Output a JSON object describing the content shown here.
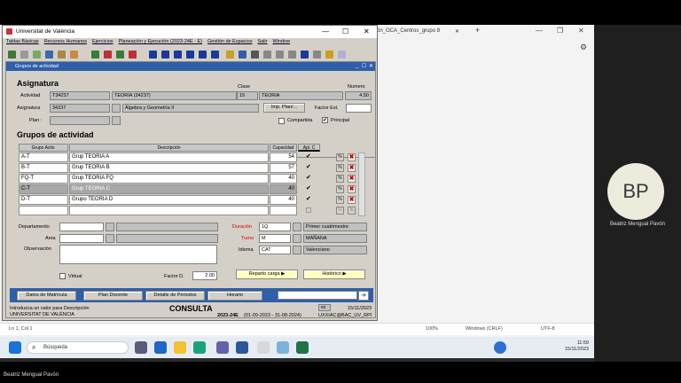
{
  "browser": {
    "tab_title": "ón_OCA_Centros_grupo 8",
    "new_tab": "+"
  },
  "app": {
    "title": "Universitat de València",
    "menu": [
      "Tablas Básicas",
      "Recursos Humanos",
      "Ejercicios",
      "Planeación y Ejecución (2023-24E - E)",
      "Gestión de Espacios",
      "Salir",
      "Window"
    ],
    "form_title": "Grupos de actividad",
    "asignatura": {
      "section": "Asignatura",
      "actividad_label": "Actividad",
      "actividad_code": "T34237",
      "actividad_desc": "TEORÍA (34237)",
      "clase_label": "Clase",
      "clase_code": "15",
      "clase_desc": "TEORIA",
      "numero_label": "Numero",
      "numero": "4.50",
      "asignatura_label": "Asignatura",
      "asignatura_code": "34237",
      "asignatura_desc": "Álgebra y Geometría II",
      "imp_plan_button": "Imp. Plan/...",
      "factor_est_label": "Factor Est.",
      "plan_label": "Plan :",
      "compartida_label": "Compartida",
      "principal_label": "Principal"
    },
    "grupos": {
      "section": "Grupos de actividad",
      "col_grupo": "Grupo Activ.",
      "col_desc": "Descripción",
      "col_cap": "Capacidad",
      "col_apl": "Apl. C",
      "rows": [
        {
          "grupo": "A-T",
          "desc": "Grup TEORIA A",
          "cap": "54",
          "apl": "✔"
        },
        {
          "grupo": "B-T",
          "desc": "Grup TEORIA B",
          "cap": "57",
          "apl": "✔"
        },
        {
          "grupo": "FQ-T",
          "desc": "Grup TEORIA FQ",
          "cap": "40",
          "apl": "✔"
        },
        {
          "grupo": "C-T",
          "desc": "Grup TEORIA C",
          "cap": "40",
          "apl": "✔"
        },
        {
          "grupo": "D-T",
          "desc": "Grupo TEORIA D",
          "cap": "40",
          "apl": "✔"
        },
        {
          "grupo": "",
          "desc": "",
          "cap": "",
          "apl": ""
        }
      ],
      "selected_row": 3,
      "pct_icon": "%",
      "delete_icon": "✖"
    },
    "details": {
      "departamento_label": "Departamento",
      "area_label": "Area",
      "observacion_label": "Observación",
      "virtual_label": "Virtual",
      "factor_d_label": "Factor D.",
      "factor_d": "2.00",
      "duracion_label": "Duración",
      "duracion_code": "1Q",
      "duracion_desc": "Primer cuatrimestre",
      "turno_label": "Turno",
      "turno_code": "M",
      "turno_desc": "MAÑANA",
      "idioma_label": "Idioma",
      "idioma_code": "CAT",
      "idioma_desc": "Valenciano",
      "reparto_button": "Reparto carga",
      "historico_button": "Histórico"
    },
    "bottom_buttons": [
      "Datos de Matrícula",
      "Plan Docente",
      "Detalle de Periodos",
      "Horario"
    ],
    "statusbar": {
      "hint": "Introduzca un valor para Descripción",
      "org": "UNIVERSITAT DE VALÈNCIA",
      "mode": "CONSULTA",
      "period": "2023-24E",
      "dates": "(01-09-2023 - 31-08-2024)",
      "es": "es",
      "date": "15/11/2023",
      "user": "UXXIAC@BAC_UV_RPI"
    }
  },
  "editor_status": {
    "position": "Ln 1, Col 1",
    "zoom": "100%",
    "eol": "Windows (CRLF)",
    "encoding": "UTF-8"
  },
  "taskbar": {
    "search": "Búsqueda",
    "time": "11:59",
    "date": "15/11/2023"
  },
  "participant": {
    "initials": "BP",
    "name": "Beatriz Mengual Pavón"
  },
  "colors": {
    "accent": "#2e5fa8",
    "delete": "#cc0000",
    "required_label": "#cc0000"
  }
}
